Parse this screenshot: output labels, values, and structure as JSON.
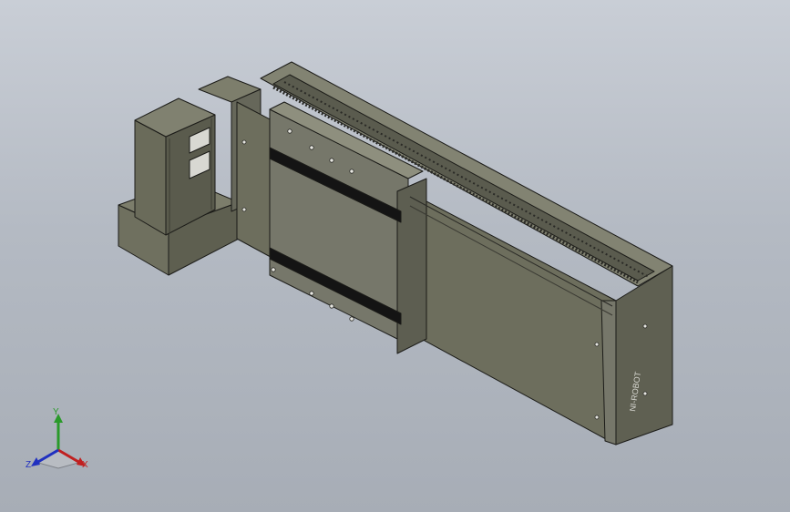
{
  "viewport": {
    "background_top": "#c9ced6",
    "background_bottom": "#a7adb6"
  },
  "model": {
    "body_color": "#6f705f",
    "body_dark": "#55564a",
    "body_light": "#8a8b78",
    "edge_color": "#1b1b18",
    "belt_color": "#141414",
    "brand_text": "NI-ROBOT"
  },
  "triad": {
    "axis_y": "Y",
    "axis_x": "X",
    "axis_z": "Z",
    "color_y": "#2a9a2a",
    "color_x": "#c02020",
    "color_z": "#2030c0"
  }
}
